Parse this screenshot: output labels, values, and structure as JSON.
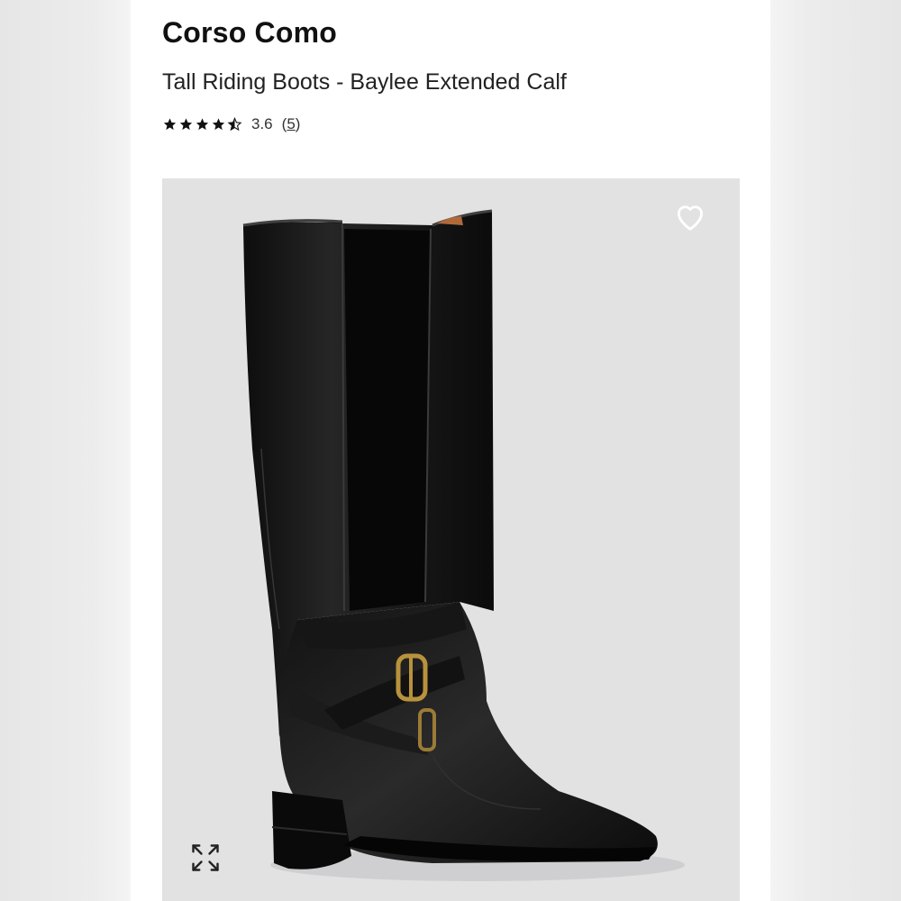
{
  "product": {
    "brand": "Corso Como",
    "title": "Tall Riding Boots - Baylee Extended Calf",
    "rating": {
      "value": 3.6,
      "value_text": "3.6",
      "review_count": "5",
      "stars": 5
    },
    "image": {
      "description_icon": "boot-image"
    }
  },
  "actions": {
    "favorite_icon": "heart-icon",
    "expand_icon": "expand-icon"
  },
  "colors": {
    "background": "#ffffff",
    "photo_bg": "#e2e2e3",
    "boot": "#151515",
    "buckle": "#b8923c"
  }
}
